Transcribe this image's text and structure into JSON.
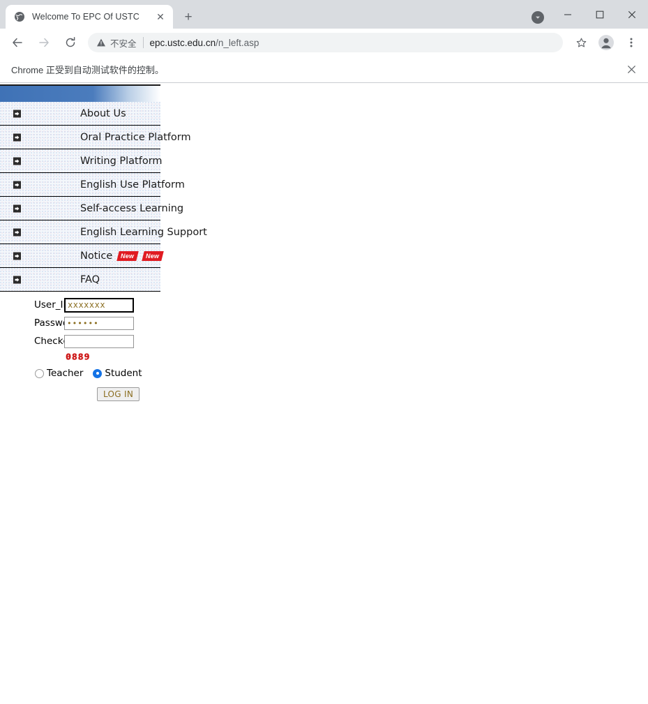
{
  "window": {
    "update_icon": "chevron-down-circle-icon",
    "minimize": "−",
    "maximize": "□",
    "close": "✕"
  },
  "tab": {
    "favicon": "globe-icon",
    "title": "Welcome To EPC Of USTC",
    "close_label": "✕",
    "new_tab_label": "+"
  },
  "toolbar": {
    "back_label": "←",
    "forward_label": "→",
    "reload_label": "⟳",
    "security_icon": "warning-triangle-icon",
    "security_text": "不安全",
    "url_host": "epc.ustc.edu.cn",
    "url_path": "/n_left.asp",
    "bookmark_icon": "star-icon",
    "profile_icon": "person-icon",
    "menu_icon": "three-dot-menu-icon"
  },
  "infobar": {
    "message": "Chrome 正受到自动测试软件的控制。",
    "close_label": "✕"
  },
  "nav": {
    "items": [
      {
        "label": "About Us",
        "bullet": "arrow-right-icon",
        "badges": []
      },
      {
        "label": "Oral Practice Platform",
        "bullet": "arrow-right-icon",
        "badges": []
      },
      {
        "label": "Writing Platform",
        "bullet": "arrow-right-icon",
        "badges": []
      },
      {
        "label": "English Use Platform",
        "bullet": "arrow-right-icon",
        "badges": []
      },
      {
        "label": "Self-access Learning",
        "bullet": "arrow-right-icon",
        "badges": []
      },
      {
        "label": "English Learning Support",
        "bullet": "arrow-right-icon",
        "badges": []
      },
      {
        "label": "Notice",
        "bullet": "arrow-right-icon",
        "badges": [
          "New",
          "New"
        ]
      },
      {
        "label": "FAQ",
        "bullet": "arrow-right-icon",
        "badges": []
      }
    ]
  },
  "login": {
    "userid_label": "User_ID",
    "userid_value": "xxxxxxx",
    "userid_placeholder": "",
    "password_label": "Password",
    "password_value": "••••••",
    "password_placeholder": "",
    "checkcode_label": "Checkcode",
    "checkcode_value": "",
    "checkcode_placeholder": "",
    "captcha_text": "0889",
    "role_teacher": "Teacher",
    "role_student": "Student",
    "selected_role": "Student",
    "submit_label": "LOG IN"
  },
  "colors": {
    "nav_header_blue": "#3f72b6",
    "badge_red": "#e01b22",
    "captcha_red": "#cc1111",
    "radio_blue": "#1473e6",
    "input_text": "#8a6d1f"
  }
}
